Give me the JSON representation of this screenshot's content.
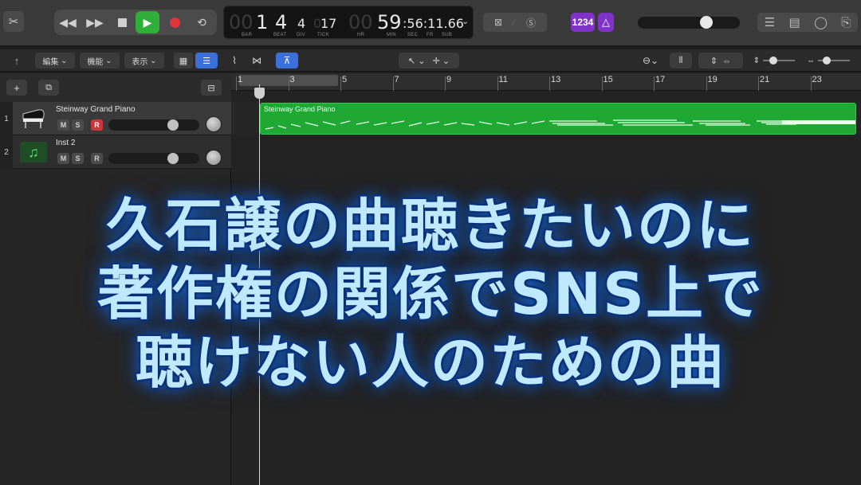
{
  "transport": {
    "bar": "1",
    "beat": "4",
    "div": "4",
    "tick": "17",
    "time": "59",
    "time_rest": ":56:11.66",
    "labels": {
      "bar": "BAR",
      "beat": "BEAT",
      "div": "DIV",
      "tick": "TICK",
      "hr": "HR",
      "min": "MIN",
      "sec": "SEC",
      "fr": "FR",
      "sub": "SUB"
    }
  },
  "key_badge": "1234",
  "menus": {
    "edit": "編集",
    "function": "機能",
    "view": "表示"
  },
  "ruler": {
    "bars": [
      "1",
      "3",
      "5",
      "7",
      "9",
      "11",
      "13",
      "15",
      "17",
      "19",
      "21",
      "23"
    ]
  },
  "tracks": [
    {
      "number": "1",
      "name": "Steinway Grand Piano",
      "icon": "grand-piano-icon",
      "mute": "M",
      "solo": "S",
      "record": "R",
      "selected": true
    },
    {
      "number": "2",
      "name": "Inst 2",
      "icon": "music-note-icon",
      "mute": "M",
      "solo": "S",
      "record": "R",
      "selected": false
    }
  ],
  "region": {
    "name": "Steinway Grand Piano",
    "color": "#1fa934"
  },
  "caption": {
    "line1": "久石譲の曲聴きたいのに",
    "line2": "著作権の関係でSNS上で",
    "line3": "聴けない人のための曲"
  },
  "colors": {
    "play": "#2fae3a",
    "record": "#e2363a",
    "accent_blue": "#3c6fd9",
    "purple": "#7f33c9"
  }
}
